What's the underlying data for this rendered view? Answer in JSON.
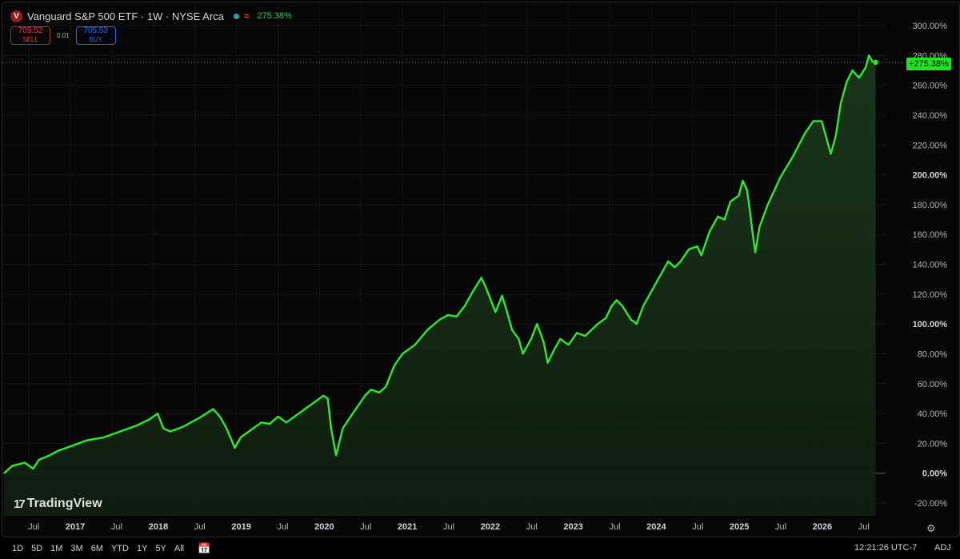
{
  "header": {
    "logo_letter": "V",
    "title": "Vanguard S&P 500 ETF · 1W · NYSE Arca",
    "wave_glyph": "≈",
    "change": "275.38%"
  },
  "trade": {
    "sell_price": "705.52",
    "sell_label": "SELL",
    "spread": "0.01",
    "buy_price": "705.53",
    "buy_label": "BUY"
  },
  "last_value_tag": "+275.38%",
  "branding": {
    "mark": "17",
    "name": "TradingView"
  },
  "colors": {
    "line": "#2bec2b",
    "background": "#000000",
    "tag": "#1ee61e",
    "sell": "#f23645",
    "buy": "#2962ff"
  },
  "icons": {
    "settings": "gear-icon",
    "date_range": "calendar-icon",
    "status": "status-dot-icon"
  },
  "bottom_bar": {
    "ranges": [
      "1D",
      "5D",
      "1M",
      "3M",
      "6M",
      "YTD",
      "1Y",
      "5Y",
      "All"
    ],
    "time": "12:21:26 UTC-7",
    "adj": "ADJ"
  },
  "chart_data": {
    "type": "area",
    "y_unit": "%",
    "ylim": [
      -25,
      305
    ],
    "y_ticks": [
      "300.00%",
      "280.00%",
      "260.00%",
      "240.00%",
      "220.00%",
      "200.00%",
      "180.00%",
      "160.00%",
      "140.00%",
      "120.00%",
      "100.00%",
      "80.00%",
      "60.00%",
      "40.00%",
      "20.00%",
      "0.00%",
      "-20.00%"
    ],
    "y_tick_values": [
      300,
      280,
      260,
      240,
      220,
      200,
      180,
      160,
      140,
      120,
      100,
      80,
      60,
      40,
      20,
      0,
      -20
    ],
    "bold_ticks": [
      "200.00%",
      "100.00%",
      "0.00%"
    ],
    "x_ticks": [
      {
        "label": "Jul",
        "t": 2016.5,
        "year": false
      },
      {
        "label": "2017",
        "t": 2017.0,
        "year": true
      },
      {
        "label": "Jul",
        "t": 2017.5,
        "year": false
      },
      {
        "label": "2018",
        "t": 2018.0,
        "year": true
      },
      {
        "label": "Jul",
        "t": 2018.5,
        "year": false
      },
      {
        "label": "2019",
        "t": 2019.0,
        "year": true
      },
      {
        "label": "Jul",
        "t": 2019.5,
        "year": false
      },
      {
        "label": "2020",
        "t": 2020.0,
        "year": true
      },
      {
        "label": "Jul",
        "t": 2020.5,
        "year": false
      },
      {
        "label": "2021",
        "t": 2021.0,
        "year": true
      },
      {
        "label": "Jul",
        "t": 2021.5,
        "year": false
      },
      {
        "label": "2022",
        "t": 2022.0,
        "year": true
      },
      {
        "label": "Jul",
        "t": 2022.5,
        "year": false
      },
      {
        "label": "2023",
        "t": 2023.0,
        "year": true
      },
      {
        "label": "Jul",
        "t": 2023.5,
        "year": false
      },
      {
        "label": "2024",
        "t": 2024.0,
        "year": true
      },
      {
        "label": "Jul",
        "t": 2024.5,
        "year": false
      },
      {
        "label": "2025",
        "t": 2025.0,
        "year": true
      },
      {
        "label": "Jul",
        "t": 2025.5,
        "year": false
      },
      {
        "label": "2026",
        "t": 2026.0,
        "year": true
      },
      {
        "label": "Jul",
        "t": 2026.5,
        "year": false
      }
    ],
    "series": [
      {
        "values": [
          [
            2016.2,
            0
          ],
          [
            2016.3,
            5
          ],
          [
            2016.45,
            7
          ],
          [
            2016.55,
            3
          ],
          [
            2016.62,
            9
          ],
          [
            2016.75,
            12
          ],
          [
            2016.85,
            15
          ],
          [
            2017.0,
            18
          ],
          [
            2017.2,
            22
          ],
          [
            2017.4,
            24
          ],
          [
            2017.6,
            28
          ],
          [
            2017.8,
            32
          ],
          [
            2017.95,
            36
          ],
          [
            2018.05,
            40
          ],
          [
            2018.12,
            30
          ],
          [
            2018.2,
            28
          ],
          [
            2018.35,
            31
          ],
          [
            2018.55,
            37
          ],
          [
            2018.72,
            43
          ],
          [
            2018.8,
            38
          ],
          [
            2018.88,
            30
          ],
          [
            2018.98,
            17
          ],
          [
            2019.05,
            24
          ],
          [
            2019.2,
            30
          ],
          [
            2019.3,
            34
          ],
          [
            2019.4,
            33
          ],
          [
            2019.5,
            38
          ],
          [
            2019.6,
            34
          ],
          [
            2019.7,
            38
          ],
          [
            2019.8,
            42
          ],
          [
            2019.9,
            46
          ],
          [
            2020.05,
            52
          ],
          [
            2020.1,
            50
          ],
          [
            2020.14,
            30
          ],
          [
            2020.2,
            12
          ],
          [
            2020.28,
            30
          ],
          [
            2020.4,
            40
          ],
          [
            2020.55,
            52
          ],
          [
            2020.62,
            56
          ],
          [
            2020.72,
            54
          ],
          [
            2020.8,
            58
          ],
          [
            2020.9,
            72
          ],
          [
            2021.0,
            80
          ],
          [
            2021.15,
            86
          ],
          [
            2021.3,
            96
          ],
          [
            2021.45,
            103
          ],
          [
            2021.55,
            106
          ],
          [
            2021.65,
            105
          ],
          [
            2021.75,
            112
          ],
          [
            2021.85,
            122
          ],
          [
            2021.95,
            131
          ],
          [
            2022.0,
            125
          ],
          [
            2022.05,
            118
          ],
          [
            2022.12,
            108
          ],
          [
            2022.2,
            119
          ],
          [
            2022.25,
            110
          ],
          [
            2022.32,
            96
          ],
          [
            2022.4,
            90
          ],
          [
            2022.45,
            80
          ],
          [
            2022.55,
            90
          ],
          [
            2022.62,
            100
          ],
          [
            2022.7,
            88
          ],
          [
            2022.75,
            74
          ],
          [
            2022.82,
            82
          ],
          [
            2022.9,
            90
          ],
          [
            2023.0,
            86
          ],
          [
            2023.1,
            94
          ],
          [
            2023.2,
            92
          ],
          [
            2023.35,
            100
          ],
          [
            2023.45,
            104
          ],
          [
            2023.52,
            112
          ],
          [
            2023.58,
            116
          ],
          [
            2023.65,
            112
          ],
          [
            2023.75,
            103
          ],
          [
            2023.82,
            100
          ],
          [
            2023.9,
            112
          ],
          [
            2024.0,
            122
          ],
          [
            2024.1,
            132
          ],
          [
            2024.2,
            142
          ],
          [
            2024.28,
            138
          ],
          [
            2024.35,
            142
          ],
          [
            2024.45,
            150
          ],
          [
            2024.55,
            152
          ],
          [
            2024.6,
            146
          ],
          [
            2024.7,
            162
          ],
          [
            2024.8,
            172
          ],
          [
            2024.88,
            170
          ],
          [
            2024.95,
            182
          ],
          [
            2025.05,
            186
          ],
          [
            2025.1,
            196
          ],
          [
            2025.15,
            190
          ],
          [
            2025.18,
            178
          ],
          [
            2025.22,
            160
          ],
          [
            2025.25,
            148
          ],
          [
            2025.3,
            165
          ],
          [
            2025.4,
            180
          ],
          [
            2025.55,
            198
          ],
          [
            2025.7,
            212
          ],
          [
            2025.85,
            228
          ],
          [
            2025.95,
            236
          ],
          [
            2026.05,
            236
          ],
          [
            2026.1,
            226
          ],
          [
            2026.16,
            214
          ],
          [
            2026.22,
            226
          ],
          [
            2026.28,
            248
          ],
          [
            2026.35,
            262
          ],
          [
            2026.42,
            270
          ],
          [
            2026.5,
            265
          ],
          [
            2026.58,
            272
          ],
          [
            2026.62,
            280
          ],
          [
            2026.66,
            276
          ],
          [
            2026.7,
            275.38
          ]
        ]
      }
    ]
  }
}
